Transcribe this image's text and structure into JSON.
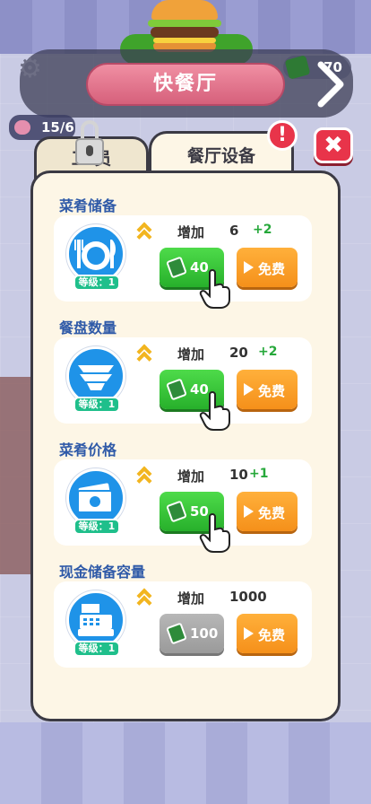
{
  "header": {
    "title": "快餐厅",
    "cash": "70"
  },
  "hud": {
    "customers": "15/6"
  },
  "tabs": {
    "staff": "工  员",
    "equipment": "餐厅设备",
    "alert_symbol": "!",
    "close_symbol": "✖"
  },
  "upgrades": [
    {
      "title": "菜肴储备",
      "icon": "plate-fork-knife-icon",
      "level": "等级：1",
      "increase_label": "增加",
      "increase_value": "6",
      "increase_delta": "+2",
      "cost": "40",
      "enabled": true,
      "free_label": "免费"
    },
    {
      "title": "餐盘数量",
      "icon": "plate-stack-icon",
      "level": "等级：1",
      "increase_label": "增加",
      "increase_value": "20",
      "increase_delta": "+2",
      "cost": "40",
      "enabled": true,
      "free_label": "免费"
    },
    {
      "title": "菜肴价格",
      "icon": "cash-bills-icon",
      "level": "等级：1",
      "increase_label": "增加",
      "increase_value": "10",
      "increase_delta": "+1",
      "cost": "50",
      "enabled": true,
      "free_label": "免费"
    },
    {
      "title": "现金储备容量",
      "icon": "cash-register-icon",
      "level": "等级：1",
      "increase_label": "增加",
      "increase_value": "1000",
      "increase_delta": "",
      "cost": "100",
      "enabled": false,
      "free_label": "免费"
    }
  ],
  "colors": {
    "accent_green": "#27b02b",
    "accent_orange": "#f5901a",
    "title_pink": "#d6607b",
    "alert_red": "#e8344a",
    "section_blue": "#2f5aa8"
  }
}
